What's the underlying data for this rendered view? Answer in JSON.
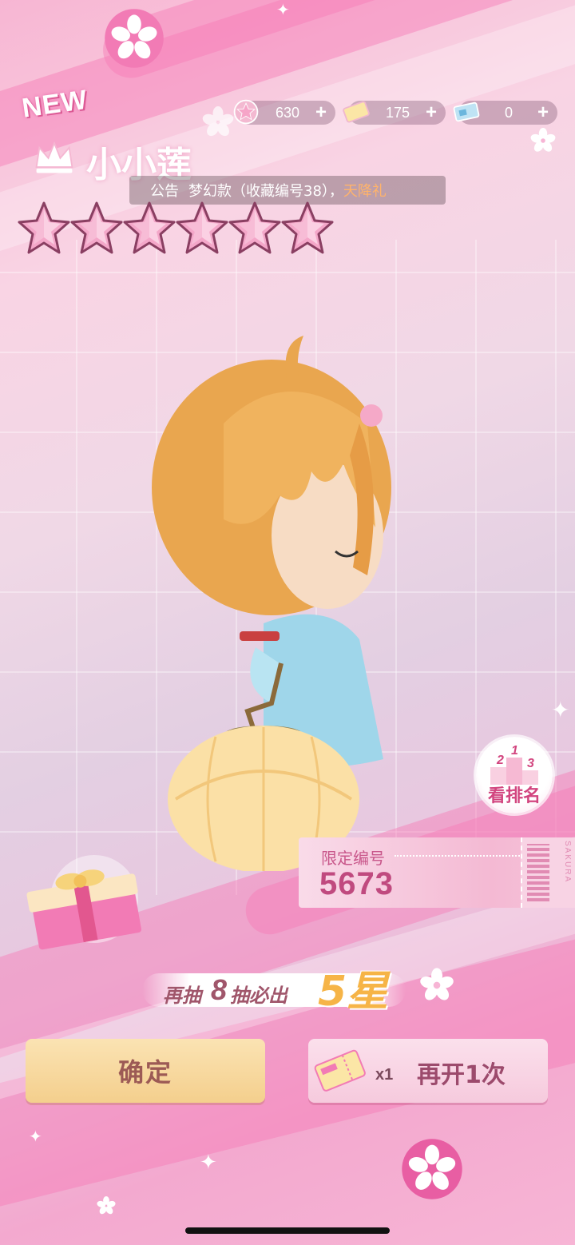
{
  "header": {
    "new_badge": "NEW",
    "character_name": "小小莲"
  },
  "currencies": [
    {
      "icon": "star-coin-icon",
      "value": "630"
    },
    {
      "icon": "ticket-icon",
      "value": "175"
    },
    {
      "icon": "card-icon",
      "value": "0"
    }
  ],
  "announcement": {
    "label": "公告",
    "text": "梦幻款（收藏编号38），",
    "highlight": "天降礼"
  },
  "rarity": {
    "stars": 6
  },
  "ranking": {
    "label": "看排名",
    "podium": [
      "2",
      "1",
      "3"
    ]
  },
  "serial": {
    "title": "限定编号",
    "number": "5673",
    "brand": "SAKURA"
  },
  "pity": {
    "prefix": "再抽",
    "count": "8",
    "middle": "抽必出",
    "reward": "5星"
  },
  "buttons": {
    "confirm": "确定",
    "again_count": "x1",
    "again": "再开1次"
  },
  "colors": {
    "accent_pink": "#f27bb5",
    "gold": "#f6b447",
    "confirm_bg": "#f4cf8d"
  }
}
